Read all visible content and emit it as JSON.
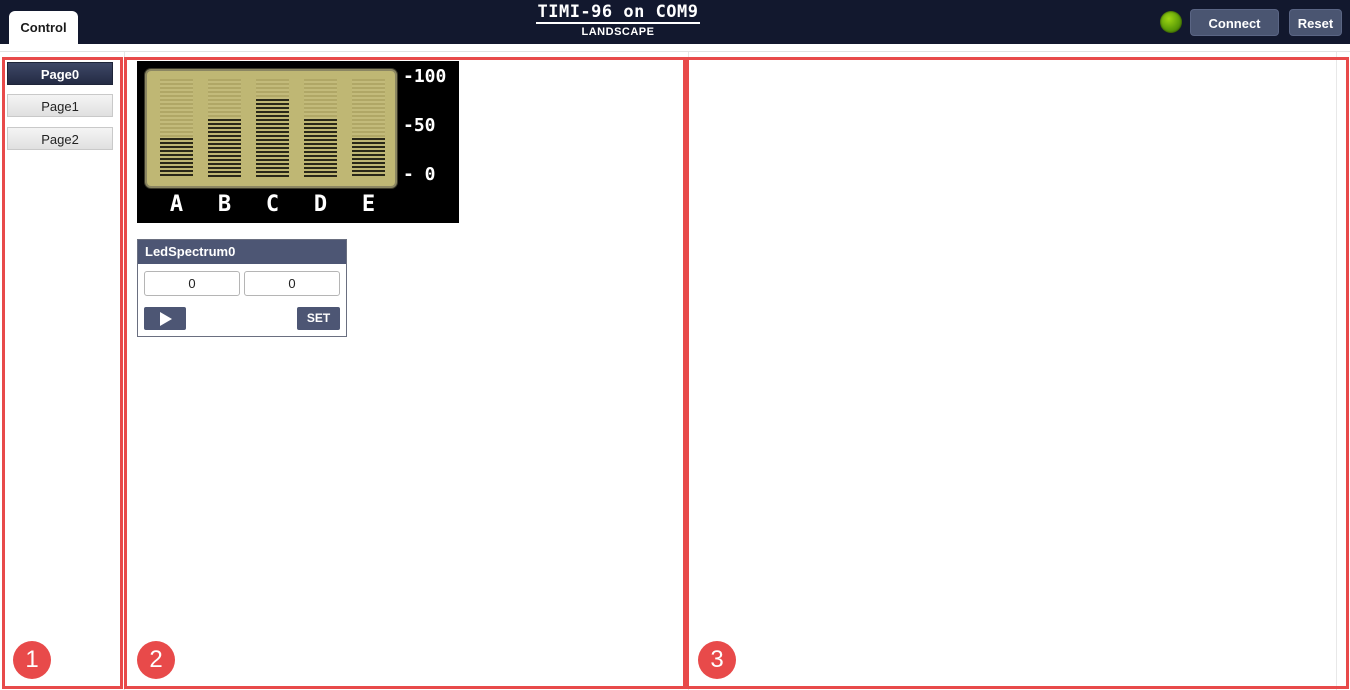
{
  "header": {
    "tab_label": "Control",
    "title": "TIMI-96 on COM9",
    "subtitle": "LANDSCAPE",
    "status_color": "#5e9e08",
    "connect_label": "Connect",
    "reset_label": "Reset"
  },
  "pages": {
    "items": [
      {
        "label": "Page0",
        "active": true
      },
      {
        "label": "Page1",
        "active": false
      },
      {
        "label": "Page2",
        "active": false
      }
    ]
  },
  "spectrum": {
    "scale": [
      "-100",
      "-50",
      "- 0"
    ],
    "bands": [
      {
        "label": "A",
        "level": 40
      },
      {
        "label": "B",
        "level": 60
      },
      {
        "label": "C",
        "level": 80
      },
      {
        "label": "D",
        "level": 60
      },
      {
        "label": "E",
        "level": 40
      }
    ]
  },
  "widget": {
    "title": "LedSpectrum0",
    "input_a": "0",
    "input_b": "0",
    "play_icon": "play-icon",
    "set_label": "SET"
  },
  "annotations": {
    "badge1": "1",
    "badge2": "2",
    "badge3": "3",
    "color": "#e84a4a"
  }
}
